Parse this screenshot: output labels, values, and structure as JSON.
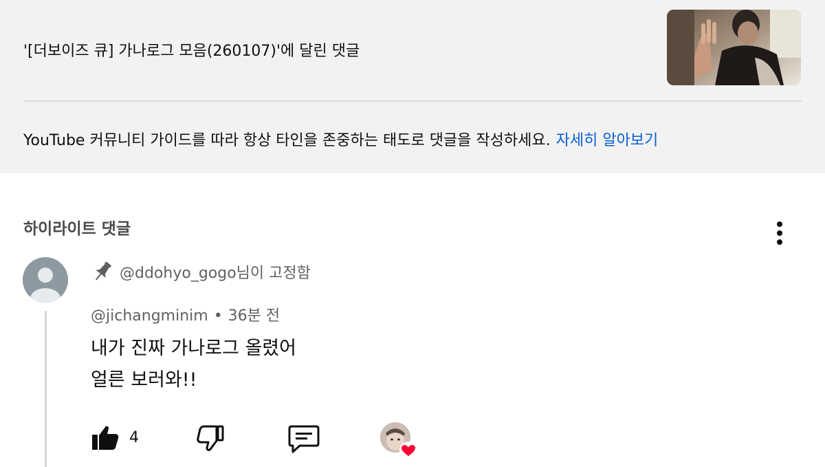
{
  "header": {
    "video_title": "'[더보이즈 큐] 가나로그 모음(260107)'에 달린 댓글",
    "guideline_text": "YouTube 커뮤니티 가이드를 따라 항상 타인을 존중하는 태도로 댓글을 작성하세요.",
    "guideline_link": "자세히 알아보기",
    "thumbnail_icon": "video-thumbnail"
  },
  "highlight": {
    "section_title": "하이라이트 댓글",
    "menu_icon": "more-vert-icon"
  },
  "comment": {
    "pinned_by": "@ddohyo_gogo님이 고정함",
    "author": "@jichangminim",
    "separator": "•",
    "time": "36분 전",
    "text_line1": "내가 진짜 가나로그 올렸어",
    "text_line2": "얼른 보러와!!",
    "like_count": "4",
    "actions": [
      "like-icon",
      "dislike-icon",
      "reply-icon",
      "creator-heart-icon"
    ]
  },
  "colors": {
    "link": "#065fd4",
    "heart": "#ff0033",
    "panel_bg": "#f2f2f2",
    "secondary_text": "#606060"
  }
}
